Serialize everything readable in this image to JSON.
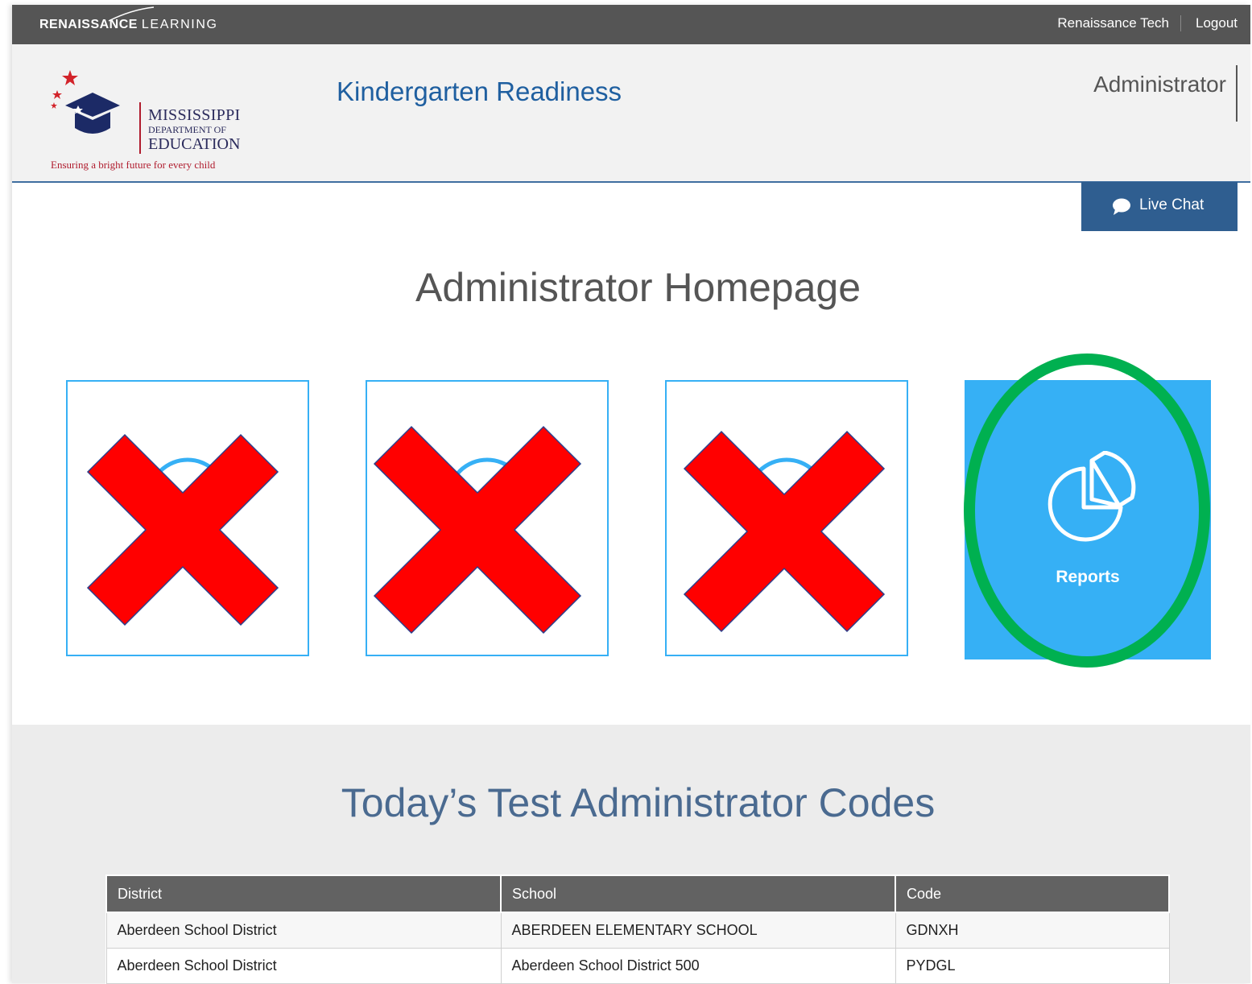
{
  "topbar": {
    "brand_bold": "RENAISSANCE",
    "brand_light": "LEARNING",
    "user_name": "Renaissance Tech",
    "logout_label": "Logout"
  },
  "header": {
    "logo": {
      "line1": "MISSISSIPPI",
      "line2": "DEPARTMENT OF",
      "line3": "EDUCATION",
      "tagline": "Ensuring a bright future for every child"
    },
    "app_title": "Kindergarten Readiness",
    "role_label": "Administrator"
  },
  "live_chat": {
    "label": "Live Chat",
    "icon": "chat-bubble-icon"
  },
  "page_title": "Administrator Homepage",
  "tiles": [
    {
      "name": "tile-1",
      "state": "crossed-out"
    },
    {
      "name": "tile-2",
      "state": "crossed-out"
    },
    {
      "name": "tile-3",
      "state": "crossed-out"
    },
    {
      "name": "reports",
      "label": "Reports",
      "icon": "pie-chart-icon",
      "highlighted": true
    }
  ],
  "colors": {
    "topbar": "#555555",
    "accent_blue": "#36b0f5",
    "chat_blue": "#2f5e90",
    "cross_red": "#ff0000",
    "highlight_green": "#00b050"
  },
  "codes": {
    "title": "Today’s Test Administrator Codes",
    "columns": [
      "District",
      "School",
      "Code"
    ],
    "rows": [
      [
        "Aberdeen School District",
        "ABERDEEN ELEMENTARY SCHOOL",
        "GDNXH"
      ],
      [
        "Aberdeen School District",
        "Aberdeen School District 500",
        "PYDGL"
      ]
    ]
  }
}
